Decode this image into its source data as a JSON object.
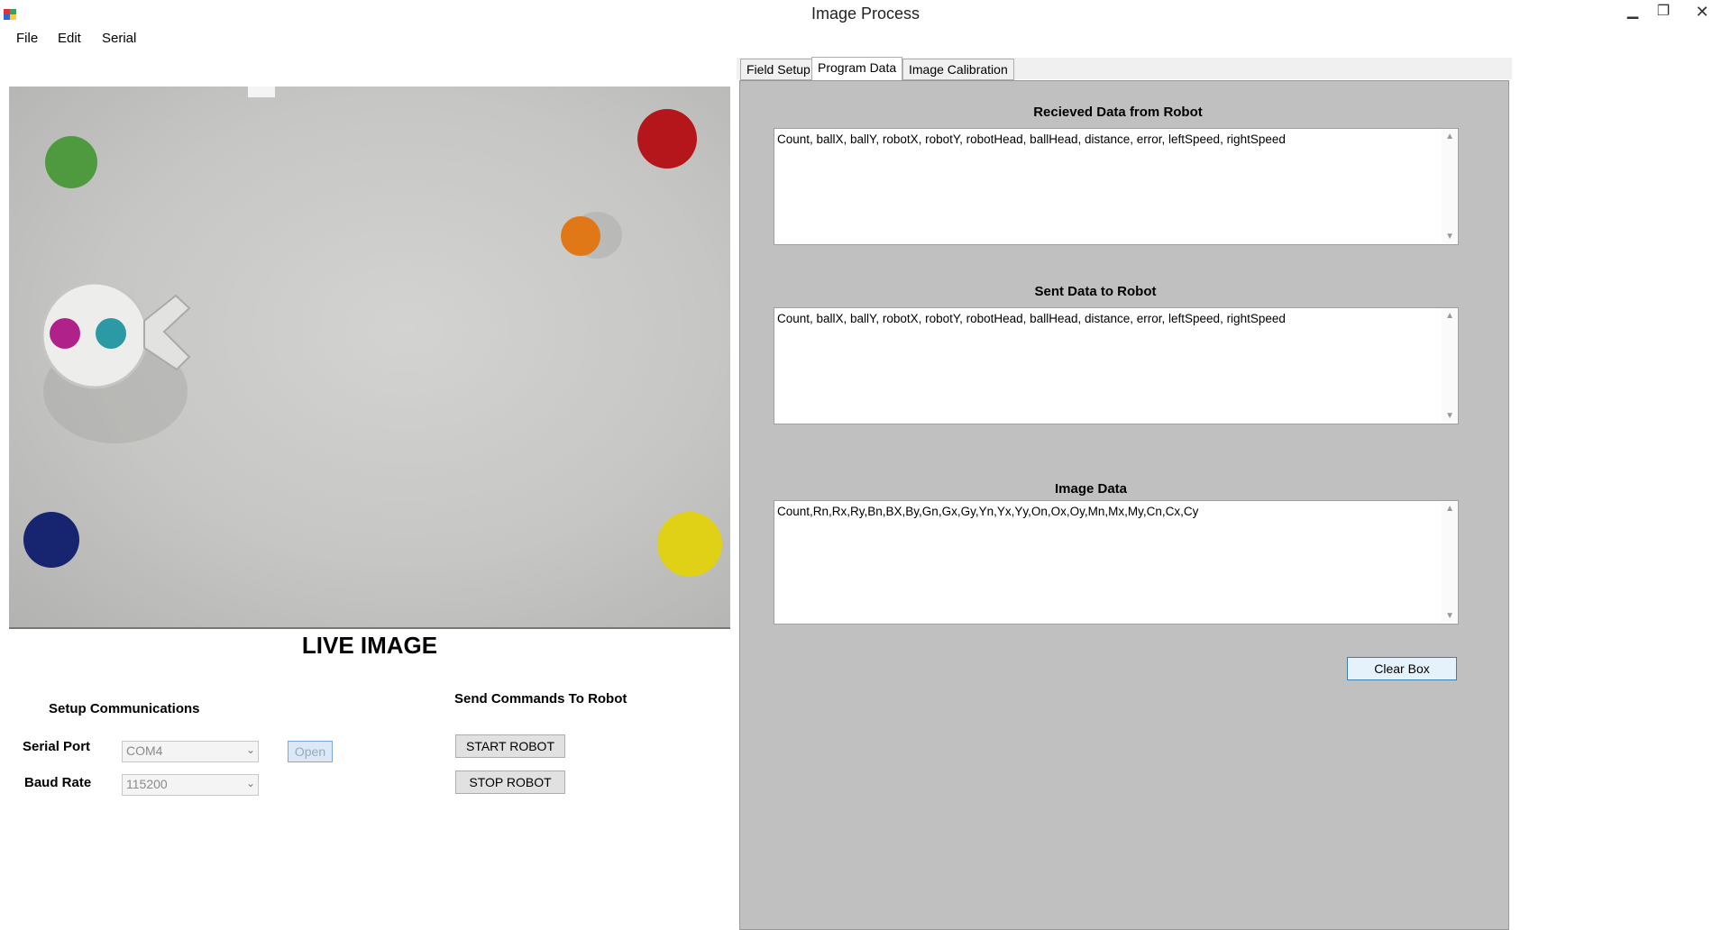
{
  "window": {
    "title": "Image Process",
    "minimize_glyph": "▁",
    "maximize_glyph": "❐",
    "close_glyph": "✕"
  },
  "menu": {
    "items": [
      "File",
      "Edit",
      "Serial"
    ]
  },
  "live_image": {
    "caption": "LIVE IMAGE"
  },
  "setup": {
    "title": "Setup Communications",
    "serial_port_label": "Serial Port",
    "serial_port_value": "COM4",
    "baud_rate_label": "Baud Rate",
    "baud_rate_value": "115200",
    "open_label": "Open"
  },
  "commands": {
    "title": "Send Commands To Robot",
    "start_label": "START ROBOT",
    "stop_label": "STOP ROBOT"
  },
  "tabs": [
    {
      "label": "Field Setup"
    },
    {
      "label": "Program Data"
    },
    {
      "label": "Image Calibration"
    }
  ],
  "program_data": {
    "received_title": "Recieved Data from Robot",
    "received_text": "Count, ballX, ballY, robotX, robotY, robotHead, ballHead, distance, error, leftSpeed, rightSpeed",
    "sent_title": "Sent Data to Robot",
    "sent_text": "Count, ballX, ballY, robotX, robotY, robotHead, ballHead, distance, error, leftSpeed, rightSpeed",
    "image_title": "Image Data",
    "image_text": "Count,Rn,Rx,Ry,Bn,BX,By,Gn,Gx,Gy,Yn,Yx,Yy,On,Ox,Oy,Mn,Mx,My,Cn,Cx,Cy",
    "clear_label": "Clear Box"
  },
  "icons": {
    "scroll_up": "▲",
    "scroll_down": "▼",
    "dropdown": "⌄"
  },
  "colors": {
    "tab_panel": "#c0c0c0",
    "focus_blue": "#3c7fb1"
  }
}
